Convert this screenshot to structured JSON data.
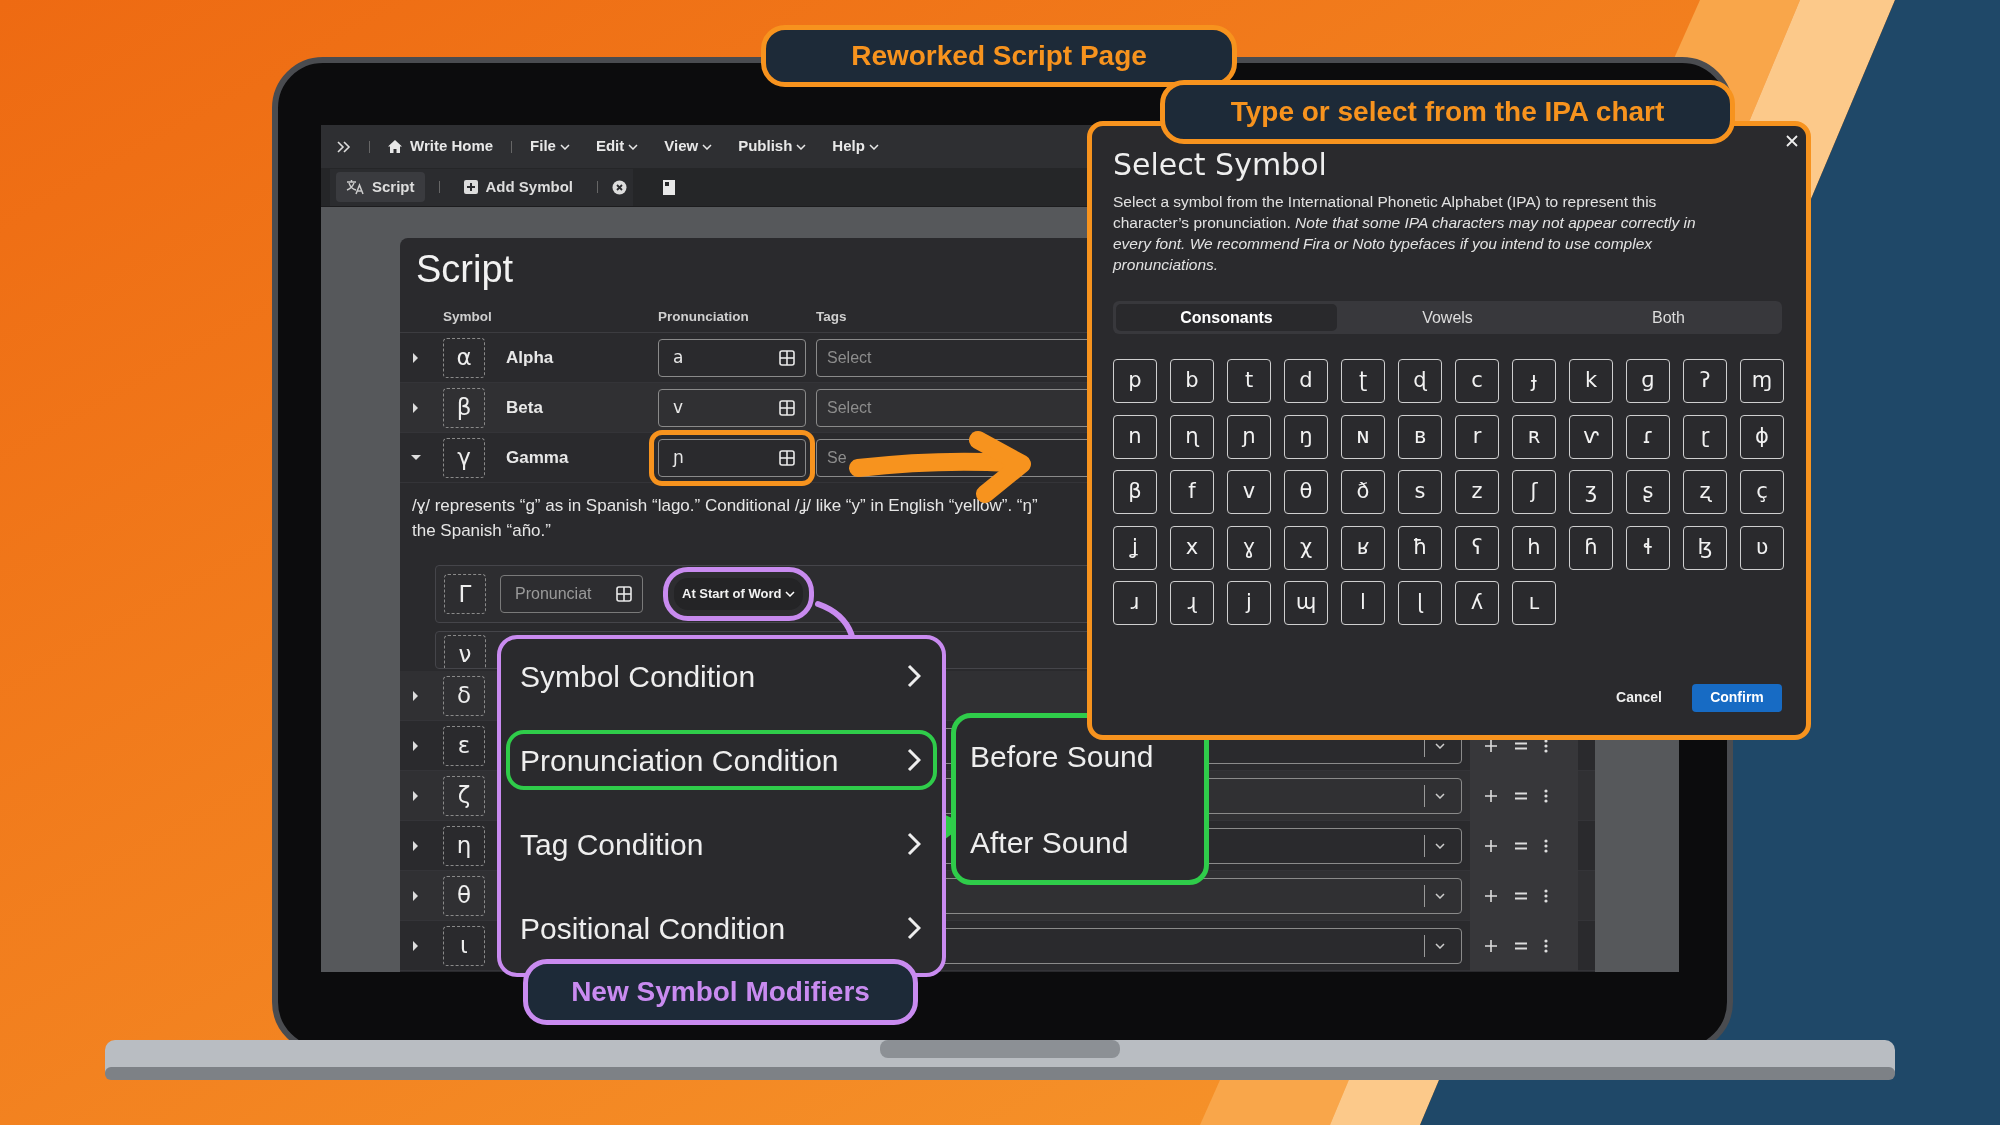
{
  "callouts": [
    {
      "text": "Reworked Script Page",
      "color": "#f7931e"
    },
    {
      "text": "Type or select from the IPA chart",
      "color": "#f7931e"
    },
    {
      "text": "New Symbol Modifiers",
      "color": "#c98bf0"
    }
  ],
  "app": {
    "home": "Write Home",
    "menus": [
      "File",
      "Edit",
      "View",
      "Publish",
      "Help"
    ],
    "tabs": [
      {
        "label": "Script",
        "selected": true
      },
      {
        "label": "Add Symbol",
        "selected": false
      }
    ]
  },
  "script": {
    "title": "Script",
    "columns": [
      "Symbol",
      "Pronunciation",
      "Tags"
    ],
    "rows": [
      {
        "kind": "entry",
        "symbol": "α",
        "name": "Alpha",
        "pronunciation": "a",
        "tags_placeholder": "Select",
        "expanded": false
      },
      {
        "kind": "entry",
        "symbol": "β",
        "name": "Beta",
        "pronunciation": "v",
        "tags_placeholder": "Select",
        "expanded": false
      },
      {
        "kind": "entry",
        "symbol": "γ",
        "name": "Gamma",
        "pronunciation": "ɲ",
        "tags_placeholder": "Se",
        "expanded": true,
        "description": [
          "/ɣ/ represents “g” as in Spanish “lago.” Conditional /ʝ/ like “y” in English “yellow”. “ŋ”",
          "the Spanish “año.”"
        ],
        "modifiers": [
          {
            "symbol": "Γ",
            "pronunciation_placeholder": "Pronunciat",
            "condition": "At Start of Word"
          },
          {
            "symbol": "ν"
          }
        ]
      },
      {
        "kind": "symbol_only",
        "symbol": "δ",
        "expanded": false
      },
      {
        "kind": "compact",
        "symbol": "ε",
        "expanded": false
      },
      {
        "kind": "compact",
        "symbol": "ζ",
        "expanded": false
      },
      {
        "kind": "compact",
        "symbol": "η",
        "expanded": false
      },
      {
        "kind": "compact",
        "symbol": "θ",
        "expanded": false
      },
      {
        "kind": "compact",
        "symbol": "ι",
        "expanded": false
      }
    ]
  },
  "condition_menu": {
    "items": [
      {
        "label": "Symbol Condition",
        "highlighted": false
      },
      {
        "label": "Pronunciation Condition",
        "highlighted": true
      },
      {
        "label": "Tag Condition",
        "highlighted": false
      },
      {
        "label": "Positional Condition",
        "highlighted": false
      }
    ]
  },
  "submenu": {
    "items": [
      "Before Sound",
      "After Sound"
    ]
  },
  "dialog": {
    "title": "Select Symbol",
    "description": "Select a symbol from the International Phonetic Alphabet (IPA) to represent this character’s pronunciation. *Note that some IPA characters may not appear correctly in every font. We recommend Fira or Noto typefaces if you intend to use complex pronunciations.*",
    "tabs": [
      {
        "label": "Consonants",
        "selected": true
      },
      {
        "label": "Vowels",
        "selected": false
      },
      {
        "label": "Both",
        "selected": false
      }
    ],
    "symbols": [
      "p",
      "b",
      "t",
      "d",
      "ʈ",
      "ɖ",
      "c",
      "ɟ",
      "k",
      "ɡ",
      "ʔ",
      "ɱ",
      "n",
      "ɳ",
      "ɲ",
      "ŋ",
      "ɴ",
      "ʙ",
      "r",
      "ʀ",
      "ⱱ",
      "ɾ",
      "ɽ",
      "ɸ",
      "β",
      "f",
      "v",
      "θ",
      "ð",
      "s",
      "z",
      "ʃ",
      "ʒ",
      "ʂ",
      "ʐ",
      "ç",
      "ʝ",
      "x",
      "ɣ",
      "χ",
      "ʁ",
      "ħ",
      "ʕ",
      "h",
      "ɦ",
      "ɬ",
      "ɮ",
      "ʋ",
      "ɹ",
      "ɻ",
      "j",
      "ɰ",
      "l",
      "ɭ",
      "ʎ",
      "ʟ"
    ],
    "cancel": "Cancel",
    "confirm": "Confirm"
  }
}
